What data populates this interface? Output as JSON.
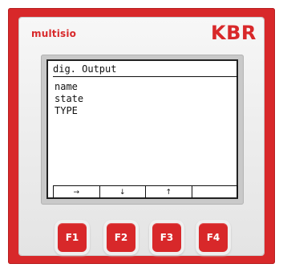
{
  "device": {
    "brand": "multisio",
    "logo": "KBR"
  },
  "screen": {
    "title": "dig. Output",
    "items": [
      "name",
      "state",
      "TYPE"
    ],
    "softkeys": [
      "→",
      "↓",
      "↑",
      ""
    ]
  },
  "buttons": [
    "F1",
    "F2",
    "F3",
    "F4"
  ],
  "colors": {
    "accent": "#d8282a",
    "panel": "#ececec",
    "lcd_background": "#ffffff",
    "lcd_text": "#111111"
  }
}
